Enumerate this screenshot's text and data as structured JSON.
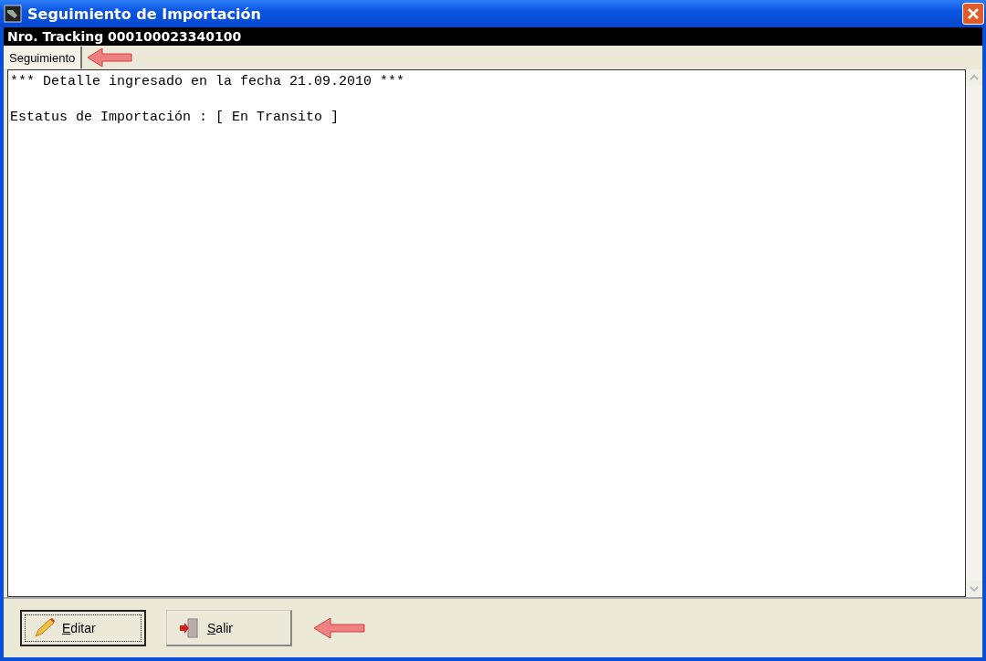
{
  "window": {
    "title": "Seguimiento de Importación"
  },
  "header": {
    "text": "Nro. Tracking 000100023340100"
  },
  "tabs": [
    {
      "label": "Seguimiento",
      "selected": true
    }
  ],
  "detail": {
    "lines": [
      "*** Detalle ingresado en la fecha 21.09.2010 ***",
      "Estatus de Importación : [ En Transito ]"
    ]
  },
  "buttons": [
    {
      "label": "Editar",
      "kind": "edit",
      "focused": true
    },
    {
      "label": "Salir",
      "kind": "exit",
      "focused": false
    }
  ]
}
